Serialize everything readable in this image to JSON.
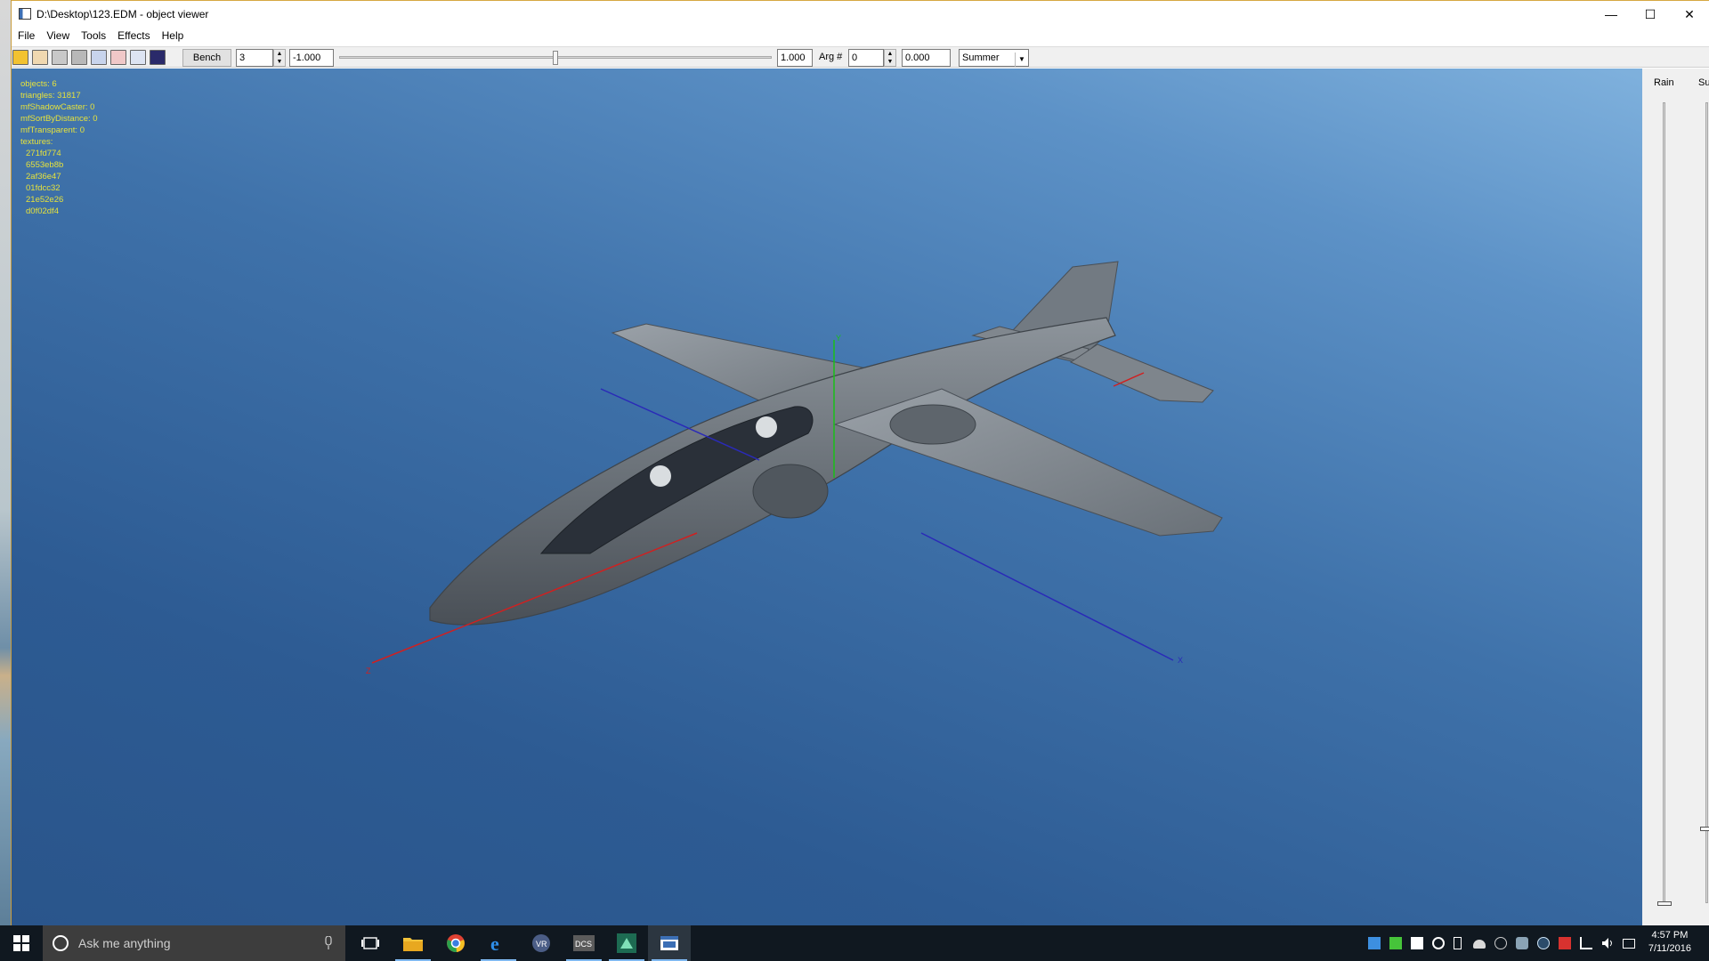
{
  "window": {
    "title": "D:\\Desktop\\123.EDM - object viewer",
    "controls": {
      "minimize": "—",
      "maximize": "☐",
      "close": "✕"
    }
  },
  "menu": {
    "items": [
      {
        "label": "File"
      },
      {
        "label": "View"
      },
      {
        "label": "Tools"
      },
      {
        "label": "Effects"
      },
      {
        "label": "Help"
      }
    ]
  },
  "toolbar": {
    "icons": [
      "open-folder-icon",
      "runner-icon",
      "undo-icon",
      "redo-icon",
      "wireframe-icon",
      "person-icon",
      "paint-icon",
      "properties-icon"
    ],
    "bench_label": "Bench",
    "bench_value": "3",
    "arg_min": "-1.000",
    "arg_max": "1.000",
    "arg_slider_level": 0.5,
    "arg_label": "Arg #",
    "arg_number": "0",
    "arg_value": "0.000",
    "season": "Summer"
  },
  "stats": {
    "lines": [
      "objects: 6",
      "triangles: 31817",
      "mfShadowCaster: 0",
      "mfSortByDistance: 0",
      "mfTransparent: 0",
      "textures:"
    ],
    "textures": [
      "271fd774",
      "6553eb8b",
      "2af36e47",
      "01fdcc32",
      "21e52e26",
      "d0f02df4"
    ]
  },
  "axes": {
    "x_label": "X",
    "y_label": "Y",
    "z_label": "Z",
    "x_color": "#2a2ab8",
    "y_color": "#18c018",
    "z_color": "#d02020"
  },
  "side_panel": {
    "rain_label": "Rain",
    "sun_label": "Sun"
  },
  "taskbar": {
    "search_placeholder": "Ask me anything",
    "apps": [
      "task-view-icon",
      "file-explorer-icon",
      "chrome-icon",
      "edge-icon",
      "vr-app-icon",
      "dcs-icon",
      "modelviewer-icon",
      "object-viewer-icon"
    ],
    "time": "4:57 PM",
    "date": "7/11/2016"
  }
}
